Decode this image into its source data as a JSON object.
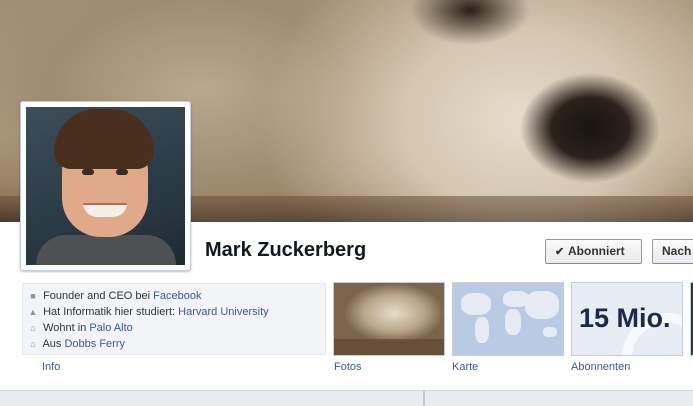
{
  "profile": {
    "name": "Mark Zuckerberg"
  },
  "actions": {
    "subscribed_label": "Abonniert",
    "message_label": "Nach"
  },
  "info": [
    {
      "icon": "briefcase-icon",
      "prefix": "Founder and CEO bei ",
      "link": "Facebook"
    },
    {
      "icon": "graduation-cap-icon",
      "prefix": "Hat Informatik hier studiert: ",
      "link": "Harvard University"
    },
    {
      "icon": "house-icon",
      "prefix": "Wohnt in ",
      "link": "Palo Alto"
    },
    {
      "icon": "home-pin-icon",
      "prefix": "Aus ",
      "link": "Dobbs Ferry"
    }
  ],
  "tabs": {
    "info": "Info",
    "photos": "Fotos",
    "map": "Karte",
    "subscribers": "Abonnenten",
    "subscribers_count": "15 Mio."
  },
  "colors": {
    "link": "#3b5998",
    "name": "#141823",
    "info_bg": "#f2f4f8"
  }
}
